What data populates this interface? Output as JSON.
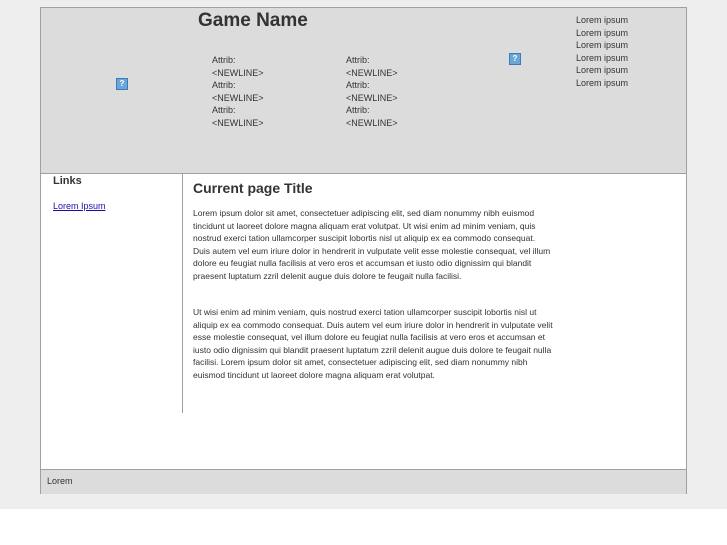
{
  "header": {
    "logo_icon": "image-placeholder-icon",
    "title": "Game Name",
    "attributes_left": [
      "Attrib:",
      "<NEWLINE>",
      "Attrib:",
      "<NEWLINE>",
      "Attrib:",
      "<NEWLINE>"
    ],
    "attributes_right": [
      "Attrib:",
      "<NEWLINE>",
      "Attrib:",
      "<NEWLINE>",
      "Attrib:",
      "<NEWLINE>"
    ],
    "header_icon": "image-placeholder-icon",
    "side_list": [
      "Lorem ipsum",
      "Lorem ipsum",
      "Lorem ipsum",
      "Lorem ipsum",
      "Lorem ipsum",
      "Lorem ipsum"
    ]
  },
  "sidebar": {
    "title": "Links",
    "links": [
      "Lorem Ipsum"
    ]
  },
  "content": {
    "title": "Current page Title",
    "paragraphs": [
      "Lorem ipsum dolor sit amet, consectetuer adipiscing elit, sed diam nonummy nibh euismod tincidunt ut laoreet dolore magna aliquam erat volutpat. Ut wisi enim ad minim veniam, quis nostrud exerci tation ullamcorper suscipit lobortis nisl ut aliquip ex ea commodo consequat. Duis autem vel eum iriure dolor in hendrerit in vulputate velit esse molestie consequat, vel illum dolore eu feugiat nulla facilisis at vero eros et accumsan et iusto odio dignissim qui blandit praesent luptatum zzril delenit augue duis dolore te feugait nulla facilisi.",
      "Ut wisi enim ad minim veniam, quis nostrud exerci tation ullamcorper suscipit lobortis nisl ut aliquip ex ea commodo consequat. Duis autem vel eum iriure dolor in hendrerit in vulputate velit esse molestie consequat, vel illum dolore eu feugiat nulla facilisis at vero eros et accumsan et iusto odio dignissim qui blandit praesent luptatum zzril delenit augue duis dolore te feugait nulla facilisi. Lorem ipsum dolor sit amet, consectetuer adipiscing elit, sed diam nonummy nibh euismod tincidunt ut laoreet dolore magna aliquam erat volutpat."
    ]
  },
  "footer": {
    "text": "Lorem"
  }
}
